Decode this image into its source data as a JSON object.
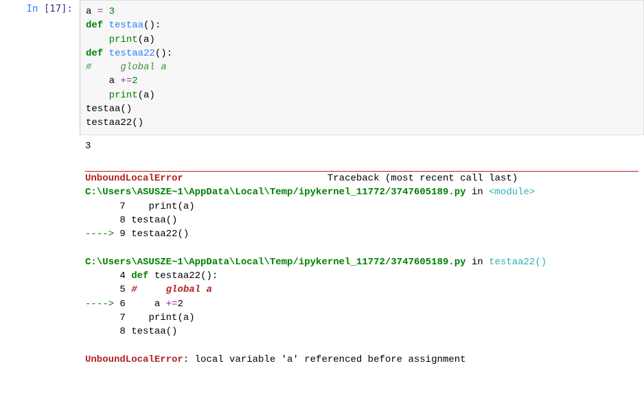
{
  "cell": {
    "in_label": "In",
    "in_number": "[17]:",
    "code": {
      "l1_var": "a",
      "l1_eq": "=",
      "l1_val": "3",
      "l2_def": "def",
      "l2_name": "testaa",
      "l2_paren": "():",
      "l3_print": "print",
      "l3_arg": "(a)",
      "l4_def": "def",
      "l4_name": "testaa22",
      "l4_paren": "():",
      "l5_hash": "#",
      "l5_comment": "global a",
      "l6_a": "a",
      "l6_op": "+=",
      "l6_val": "2",
      "l7_print": "print",
      "l7_arg": "(a)",
      "l8_call": "testaa",
      "l8_paren": "()",
      "l9_call": "testaa22",
      "l9_paren": "()"
    }
  },
  "output": {
    "stdout": "3",
    "tb": {
      "err_name": "UnboundLocalError",
      "header_right": "Traceback (most recent call last)",
      "frame1": {
        "path": "C:\\Users\\ASUSZE~1\\AppData\\Local\\Temp/ipykernel_11772/3747605189.py",
        "in": " in ",
        "loc": "<module>",
        "l7_num": "7",
        "l7_print": "print",
        "l7_arg": "(a)",
        "l8_num": "8",
        "l8_call": "testaa",
        "l8_paren": "()",
        "arrow": "----> ",
        "l9_num": "9",
        "l9_call": "testaa22",
        "l9_paren": "()"
      },
      "frame2": {
        "path": "C:\\Users\\ASUSZE~1\\AppData\\Local\\Temp/ipykernel_11772/3747605189.py",
        "in": " in ",
        "loc": "testaa22",
        "loc_paren": "()",
        "l4_num": "4",
        "l4_def": "def",
        "l4_name": "testaa22",
        "l4_paren": "():",
        "l5_num": "5",
        "l5_hash": "#",
        "l5_comment": "global a",
        "arrow": "----> ",
        "l6_num": "6",
        "l6_a": "a",
        "l6_op": "+=",
        "l6_val": "2",
        "l7_num": "7",
        "l7_print": "print",
        "l7_arg": "(a)",
        "l8_num": "8",
        "l8_call": "testaa",
        "l8_paren": "()"
      },
      "final_name": "UnboundLocalError",
      "final_msg": ": local variable 'a' referenced before assignment"
    }
  }
}
